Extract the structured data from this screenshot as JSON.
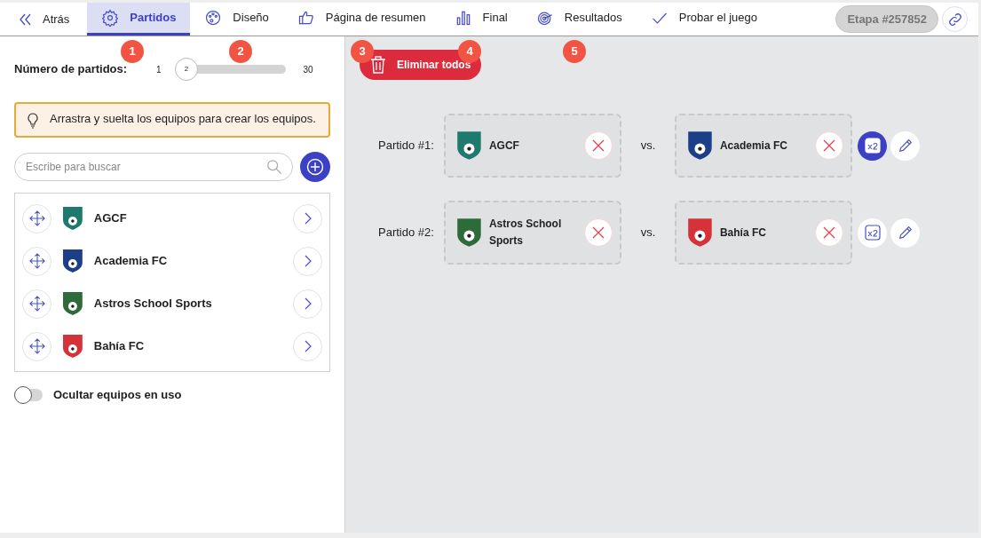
{
  "nav": {
    "back": "Atrás",
    "tabs": [
      {
        "label": "Partidos",
        "kind": "gear",
        "selected": true
      },
      {
        "label": "Diseño",
        "kind": "palette",
        "selected": false
      },
      {
        "label": "Página de resumen",
        "kind": "thumb",
        "selected": false
      },
      {
        "label": "Final",
        "kind": "bars",
        "selected": false
      },
      {
        "label": "Resultados",
        "kind": "target",
        "selected": false
      },
      {
        "label": "Probar el juego",
        "kind": "check",
        "selected": false
      }
    ],
    "stage": "Etapa #257852"
  },
  "callouts": [
    "1",
    "2",
    "3",
    "4",
    "5"
  ],
  "settings": {
    "label": "Número de partidos:",
    "min": "1",
    "max": "30",
    "value": "2",
    "level": 0.034
  },
  "hint": "Arrastra y suelta los equipos para crear los equipos.",
  "search": {
    "placeholder": "Escribe para buscar"
  },
  "teams": [
    {
      "name": "AGCF",
      "color": "#1f7a6e"
    },
    {
      "name": "Academia FC",
      "color": "#1d3f8a"
    },
    {
      "name": "Astros School Sports",
      "color": "#2e6b3a"
    },
    {
      "name": "Bahía FC",
      "color": "#d6323a"
    }
  ],
  "hide_used": {
    "label": "Ocultar equipos en uso",
    "on": false
  },
  "delete_all": "Eliminar todos",
  "matches": [
    {
      "label": "Partido #1:",
      "home": {
        "name": "AGCF",
        "color": "#1f7a6e"
      },
      "vs": "vs.",
      "away": {
        "name": "Academia FC",
        "color": "#1d3f8a"
      },
      "double": true
    },
    {
      "label": "Partido #2:",
      "home": {
        "name": "Astros School Sports",
        "color": "#2e6b3a"
      },
      "vs": "vs.",
      "away": {
        "name": "Bahía FC",
        "color": "#d6323a"
      },
      "double": false
    }
  ]
}
